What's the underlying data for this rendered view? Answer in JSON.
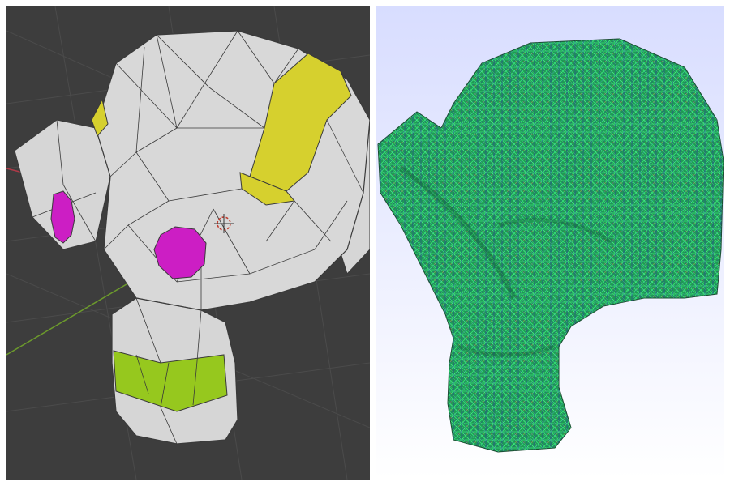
{
  "left_viewport": {
    "background": "#3d3d3d",
    "grid_line": "#4a4a4a",
    "mesh_fill": "#d6d6d6",
    "mesh_edge": "#3a3a3a",
    "yellow_region": "#d6d02e",
    "eye_color": "#cc1ec4",
    "neck_band": "#96c81e",
    "axis_x_color": "#b03a48",
    "axis_y_color": "#6c9a2c",
    "cursor_icon": "3d-cursor-icon"
  },
  "right_viewport": {
    "bg_top": "#d8ddff",
    "bg_bottom": "#ffffff",
    "mesh_fill": "#1f9a55",
    "wire_green": "#36e07a",
    "wire_blue": "#2a3aa0",
    "wire_red": "#b84a3a"
  }
}
